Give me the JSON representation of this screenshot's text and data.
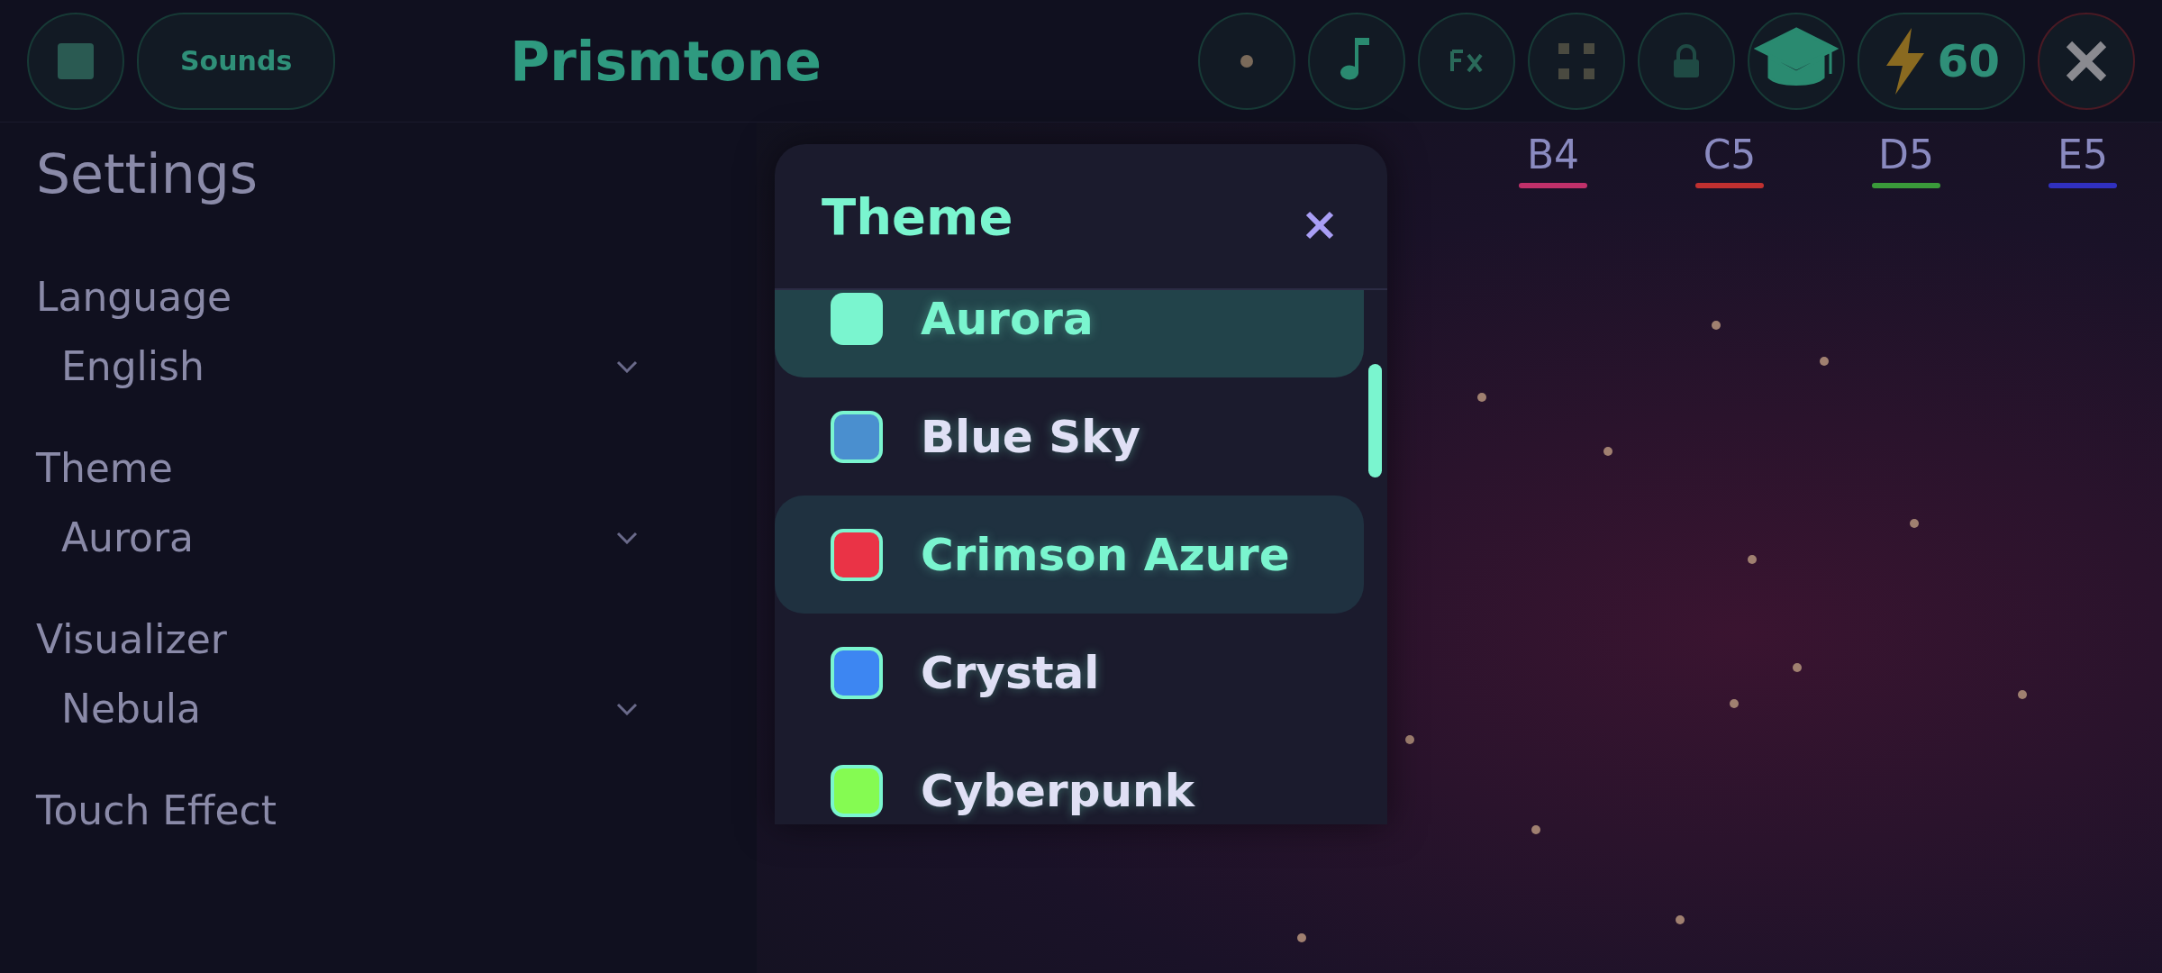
{
  "top_bar": {
    "sounds_label": "Sounds",
    "app_title": "Prismtone",
    "energy_count": "60"
  },
  "settings": {
    "title": "Settings",
    "sections": [
      {
        "label": "Language",
        "value": "English"
      },
      {
        "label": "Theme",
        "value": "Aurora"
      },
      {
        "label": "Visualizer",
        "value": "Nebula"
      },
      {
        "label": "Touch Effect"
      }
    ]
  },
  "note_labels": [
    {
      "label": "B4",
      "color": "#c0306a"
    },
    {
      "label": "C5",
      "color": "#c03030"
    },
    {
      "label": "D5",
      "color": "#3a9a3a"
    },
    {
      "label": "E5",
      "color": "#3030c0"
    }
  ],
  "theme_dialog": {
    "title": "Theme",
    "items": [
      {
        "name": "Aurora",
        "color": "#7af5cf",
        "selected": true,
        "focused": false
      },
      {
        "name": "Blue Sky",
        "color": "#4a8fcf",
        "selected": false,
        "focused": false
      },
      {
        "name": "Crimson Azure",
        "color": "#ea3346",
        "selected": false,
        "focused": true
      },
      {
        "name": "Crystal",
        "color": "#3d86f2",
        "selected": false,
        "focused": false
      },
      {
        "name": "Cyberpunk",
        "color": "#85fb52",
        "selected": false,
        "focused": false
      }
    ]
  }
}
